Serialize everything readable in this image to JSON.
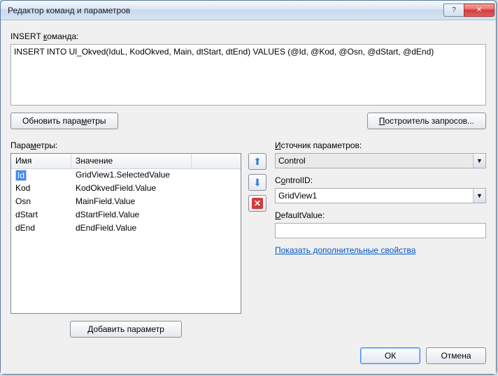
{
  "window": {
    "title": "Редактор команд и параметров"
  },
  "labels": {
    "insert_cmd_pre": "INSERT ",
    "insert_cmd_u": "к",
    "insert_cmd_post": "оманда:",
    "refresh_params_pre": "Обновить пара",
    "refresh_params_u": "м",
    "refresh_params_post": "етры",
    "query_builder_pre": "",
    "query_builder_u": "П",
    "query_builder_post": "остроитель запросов...",
    "parameters_pre": "Пара",
    "parameters_u": "м",
    "parameters_post": "етры:",
    "param_source_pre": "",
    "param_source_u": "И",
    "param_source_post": "сточник параметров:",
    "controlid_pre": "C",
    "controlid_u": "o",
    "controlid_post": "ntrolID:",
    "defaultvalue_pre": "",
    "defaultvalue_u": "D",
    "defaultvalue_post": "efaultValue:",
    "show_advanced": "Показать дополнительные свойства",
    "add_param_pre": "",
    "add_param_u": "Д",
    "add_param_post": "обавить параметр",
    "ok": "ОК",
    "cancel": "Отмена"
  },
  "sql": "INSERT INTO Ul_Okved(IduL, KodOkved, Main, dtStart, dtEnd) VALUES (@Id, @Kod, @Osn, @dStart, @dEnd)",
  "grid": {
    "headers": {
      "name": "Имя",
      "value": "Значение"
    },
    "rows": [
      {
        "name": "Id",
        "value": "GridView1.SelectedValue",
        "selected": true
      },
      {
        "name": "Kod",
        "value": "KodOkvedField.Value"
      },
      {
        "name": "Osn",
        "value": "MainField.Value"
      },
      {
        "name": "dStart",
        "value": "dStartField.Value"
      },
      {
        "name": "dEnd",
        "value": "dEndField.Value"
      }
    ]
  },
  "source": {
    "combo": "Control",
    "controlid": "GridView1",
    "defaultvalue": ""
  }
}
